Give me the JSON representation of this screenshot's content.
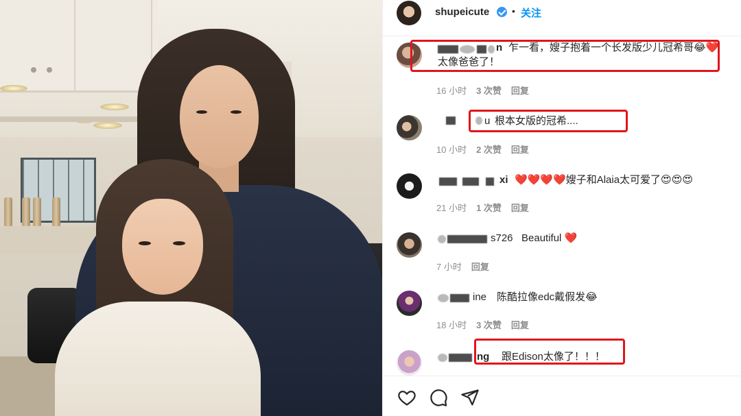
{
  "post": {
    "username": "shupeicute",
    "separator": "•",
    "follow_label": "关注"
  },
  "comments": [
    {
      "user_suffix": "n",
      "text_line1": "乍一看，嫂子抱着一个长发版少儿冠希哥😂❤️",
      "text_line2": "太像爸爸了！",
      "time": "16 小时",
      "likes": "3 次赞",
      "reply": "回复"
    },
    {
      "user_suffix": "u",
      "text_line1": "根本女版的冠希....",
      "time": "10 小时",
      "likes": "2 次赞",
      "reply": "回复"
    },
    {
      "user_suffix": "xi",
      "text_line1": "❤️❤️❤️❤️嫂子和Alaia太可爱了😍😍😍",
      "time": "21 小时",
      "likes": "1 次赞",
      "reply": "回复"
    },
    {
      "user_suffix": "s726",
      "text_line1": "Beautiful ❤️",
      "time": "7 小时",
      "reply": "回复"
    },
    {
      "user_suffix": "ine",
      "text_line1": "陈酷拉像edc戴假发😂",
      "time": "18 小时",
      "likes": "3 次赞",
      "reply": "回复"
    },
    {
      "user_suffix": "ng",
      "text_line1": "跟Edison太像了！！！"
    }
  ],
  "action_bar": {
    "icons": [
      "heart-icon",
      "comment-icon",
      "share-icon"
    ]
  },
  "colors": {
    "highlight_box": "#e0151c",
    "link_blue": "#0095f6",
    "verified_blue": "#3897f0",
    "meta_gray": "#8e8e8e"
  }
}
